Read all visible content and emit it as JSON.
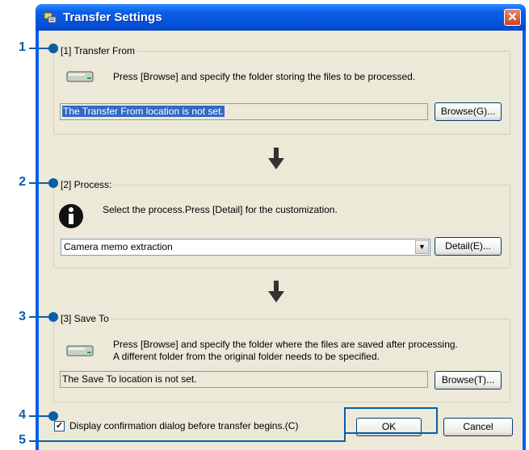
{
  "window": {
    "title": "Transfer Settings",
    "close_glyph": "✕"
  },
  "transfer_from": {
    "label": "[1] Transfer From",
    "description": "Press [Browse] and specify the folder storing the files to be processed.",
    "location": "The Transfer From location is not set.",
    "browse_label": "Browse(G)..."
  },
  "process": {
    "label": "[2] Process:",
    "description": "Select the process.Press [Detail] for the customization.",
    "selected": "Camera memo extraction",
    "detail_label": "Detail(E)..."
  },
  "save_to": {
    "label": "[3] Save To",
    "description_line1": "Press [Browse] and specify the folder where the files are saved after processing.",
    "description_line2": "A different folder from the original folder needs to be specified.",
    "location": "The Save To location is not set.",
    "browse_label": "Browse(T)..."
  },
  "confirm": {
    "label": "Display confirmation dialog before transfer begins.(C)",
    "checked": true
  },
  "buttons": {
    "ok": "OK",
    "cancel": "Cancel"
  },
  "callouts": [
    "1",
    "2",
    "3",
    "4",
    "5"
  ],
  "colors": {
    "callout": "#0a5ea8",
    "titlebar": "#0553dc"
  }
}
